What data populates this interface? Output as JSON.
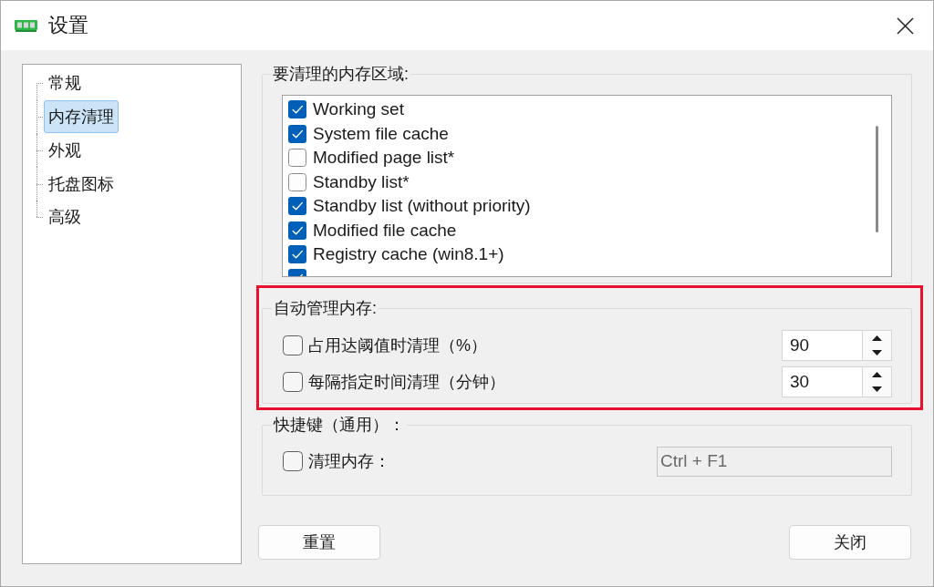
{
  "window": {
    "title": "设置"
  },
  "sidebar": {
    "items": [
      {
        "label": "常规",
        "selected": false
      },
      {
        "label": "内存清理",
        "selected": true
      },
      {
        "label": "外观",
        "selected": false
      },
      {
        "label": "托盘图标",
        "selected": false
      },
      {
        "label": "高级",
        "selected": false
      }
    ]
  },
  "memory_areas": {
    "title": "要清理的内存区域:",
    "items": [
      {
        "label": "Working set",
        "checked": true
      },
      {
        "label": "System file cache",
        "checked": true
      },
      {
        "label": "Modified page list*",
        "checked": false
      },
      {
        "label": "Standby list*",
        "checked": false
      },
      {
        "label": "Standby list (without priority)",
        "checked": true
      },
      {
        "label": "Modified file cache",
        "checked": true
      },
      {
        "label": "Registry cache (win8.1+)",
        "checked": true
      },
      {
        "checked": true
      }
    ]
  },
  "auto_manage": {
    "title": "自动管理内存:",
    "highlighted": true,
    "rows": [
      {
        "label": "占用达阈值时清理（%）",
        "checked": false,
        "value": "90"
      },
      {
        "label": "每隔指定时间清理（分钟）",
        "checked": false,
        "value": "30"
      }
    ]
  },
  "hotkeys": {
    "title": "快捷键（通用）：",
    "rows": [
      {
        "label": "清理内存：",
        "checked": false,
        "value": "Ctrl + F1",
        "disabled": true
      }
    ]
  },
  "buttons": [
    {
      "label": "重置"
    },
    {
      "label": "关闭"
    }
  ]
}
